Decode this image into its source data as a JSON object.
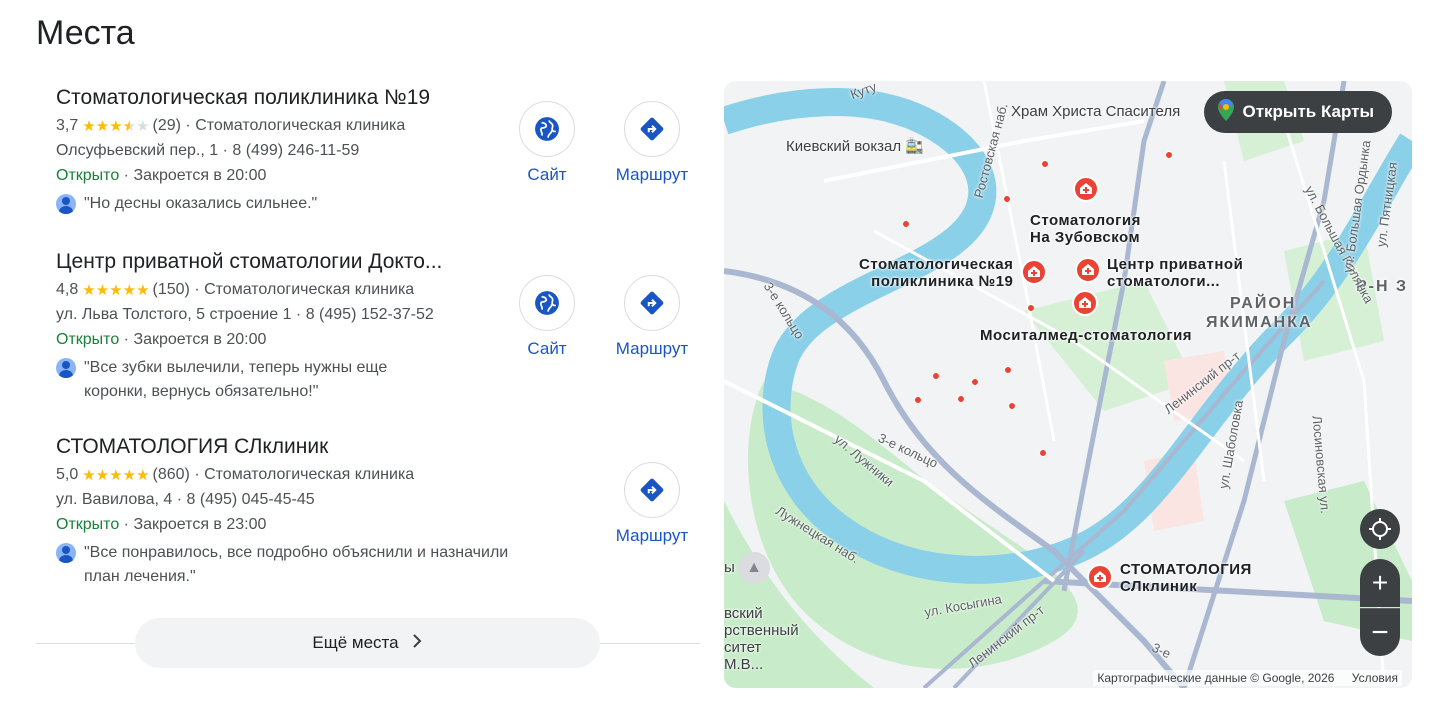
{
  "heading": "Места",
  "places": [
    {
      "name": "Стоматологическая поликлиника №19",
      "rating": "3,7",
      "rating_value": 3.7,
      "reviews": "(29)",
      "category": "Стоматологическая клиника",
      "address_line": "Олсуфьевский пер., 1 · 8 (499) 246-11-59",
      "status": "Открыто",
      "hours": "Закроется в 20:00",
      "review": "\"Но десны оказались сильнее.\"",
      "review_line2": ""
    },
    {
      "name": "Центр приватной стоматологии Докто...",
      "rating": "4,8",
      "rating_value": 4.8,
      "reviews": "(150)",
      "category": "Стоматологическая клиника",
      "address_line": "ул. Льва Толстого, 5 строение 1 · 8 (495) 152-37-52",
      "status": "Открыто",
      "hours": "Закроется в 20:00",
      "review": "\"Все зубки вылечили, теперь нужны еще",
      "review_line2": "коронки, вернусь обязательно!\""
    },
    {
      "name": "СТОМАТОЛОГИЯ СЛклиник",
      "rating": "5,0",
      "rating_value": 5.0,
      "reviews": "(860)",
      "category": "Стоматологическая клиника",
      "address_line": "ул. Вавилова, 4 · 8 (495) 045-45-45",
      "status": "Открыто",
      "hours": "Закроется в 23:00",
      "review": "\"Все понравилось, все подробно объяснили и назначили",
      "review_line2": "план лечения.\""
    }
  ],
  "actions": {
    "website": "Сайт",
    "route": "Маршрут"
  },
  "more_button": "Ещё места",
  "map": {
    "open_maps": "Открыть Карты",
    "labels": {
      "kievsky": "Киевский вокзал",
      "temple": "Храм Христа Спасителя",
      "zubovsky_1": "Стоматология",
      "zubovsky_2": "На Зубовском",
      "clinic19_1": "Стоматологическая",
      "clinic19_2": "поликлиника №19",
      "private_1": "Центр приватной",
      "private_2": "стоматологи...",
      "mositalmed": "Моситалмед-стоматология",
      "district_1": "РАЙОН",
      "district_2": "ЯКИМАНКА",
      "slklinik_1": "СТОМАТОЛОГИЯ",
      "slklinik_2": "СЛклиник",
      "rayon_z": "Р-Н З",
      "ring1": "3-е кольцо",
      "ring2": "3-е кольцо",
      "luzhniki": "ул. Лужники",
      "luzhnetskaya": "Лужнецкая наб.",
      "kosygina": "ул. Косыгина",
      "leninsky1": "Ленинский пр-т",
      "leninsky2": "Ленинский пр-т",
      "shabolovka": "ул. Шаболовка",
      "losinoostrovskaya": "Лосиновская ул.",
      "b_polyanka": "ул. Большая Полянка",
      "b_ordynka": "ул. Большая Ордынка",
      "pyatnitskaya": "ул. Пятницкая",
      "rostovskaya": "Ростовская наб.",
      "kutuzovsky": "Куту",
      "msu_1": "вский",
      "msu_2": "рственный",
      "msu_3": "ситет",
      "msu_4": "М.В...",
      "edge_y": "ы",
      "edge_3": "3-е"
    },
    "attribution": "Картографические данные © Google, 2026",
    "terms": "Условия"
  },
  "colors": {
    "link": "#1a56c2",
    "open": "#188038",
    "star": "#fbbc04",
    "water": "#8ad0e8",
    "park": "#c8ebc9",
    "pin": "#ea4335"
  }
}
